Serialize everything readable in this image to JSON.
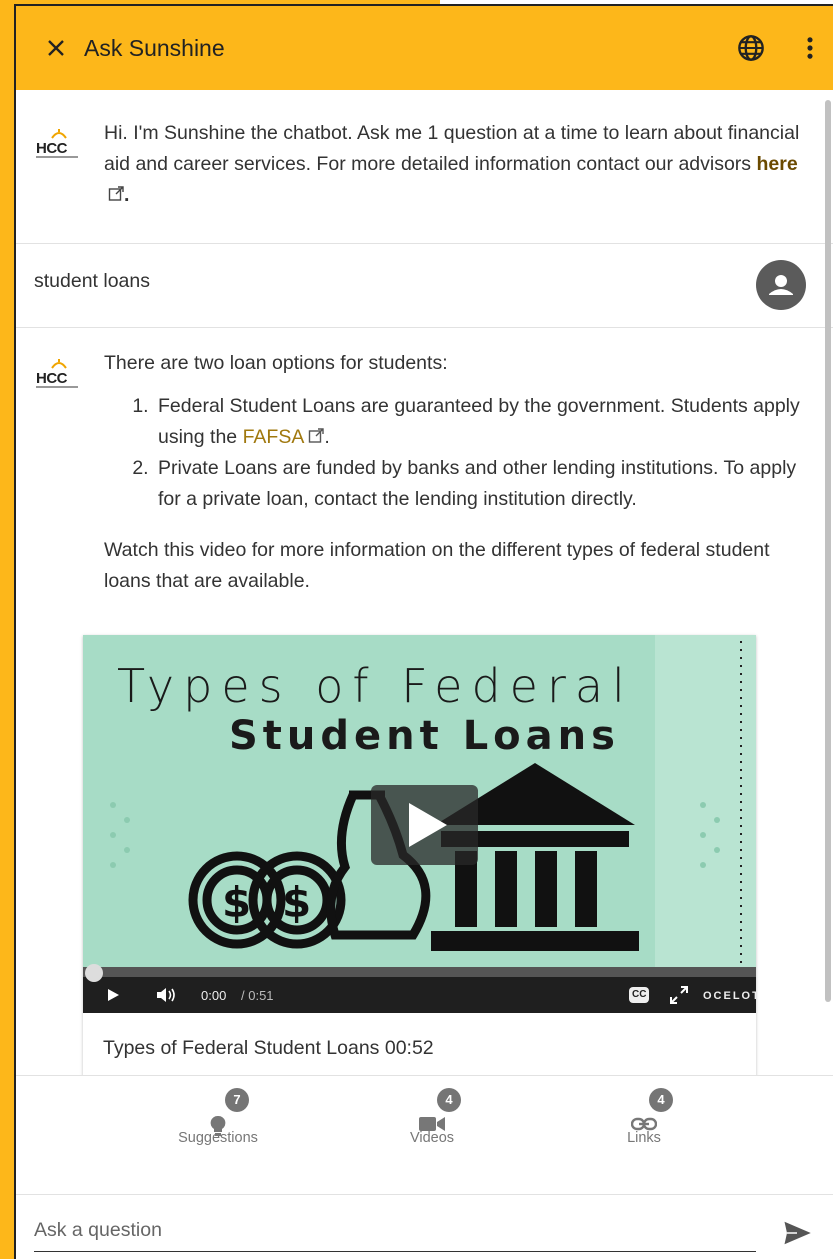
{
  "header": {
    "title": "Ask Sunshine",
    "close_icon": "close-icon",
    "globe_icon": "globe-icon",
    "more_icon": "more-vert-icon",
    "bg_color": "#FDB71A"
  },
  "logo": {
    "text": "HCC"
  },
  "messages": {
    "welcome": {
      "text": "Hi. I'm Sunshine the chatbot. Ask me 1 question at a time to learn about financial aid and career services. For more detailed information contact our advisors ",
      "link_label": "here",
      "after_link": "."
    },
    "user": {
      "text": "student loans"
    },
    "answer": {
      "intro": "There are two loan options for students:",
      "items": [
        {
          "before": "Federal Student Loans are guaranteed by the government. Students apply using the ",
          "link": "FAFSA",
          "after": "."
        },
        {
          "text": "Private Loans are funded by banks and other lending institutions. To apply for a private loan, contact the lending institution directly."
        }
      ],
      "watch": "Watch this video for more information on the different types of federal student loans that are available."
    }
  },
  "video": {
    "title_line1": "Types of Federal",
    "title_line2": "Student Loans",
    "current_time": "0:00",
    "duration": "/ 0:51",
    "cc_label": "CC",
    "brand": "OCELOT",
    "caption": "Types of Federal Student Loans  00:52",
    "progress_fraction": 0.0
  },
  "toolbar": {
    "suggestions": {
      "label": "Suggestions",
      "count": "7"
    },
    "videos": {
      "label": "Videos",
      "count": "4"
    },
    "links": {
      "label": "Links",
      "count": "4"
    }
  },
  "input": {
    "placeholder": "Ask a question"
  }
}
